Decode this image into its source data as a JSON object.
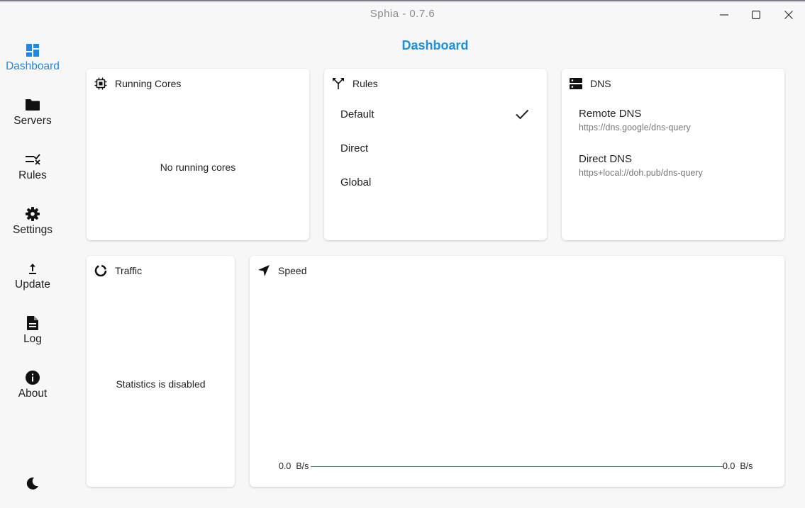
{
  "window": {
    "title": "Sphia - 0.7.6",
    "controls": [
      "minimize-icon",
      "maximize-icon",
      "close-icon"
    ]
  },
  "sidebar": {
    "items": [
      {
        "label": "Dashboard",
        "icon": "dashboard-icon",
        "active": true
      },
      {
        "label": "Servers",
        "icon": "folder-icon",
        "active": false
      },
      {
        "label": "Rules",
        "icon": "rules-icon",
        "active": false
      },
      {
        "label": "Settings",
        "icon": "gear-icon",
        "active": false
      },
      {
        "label": "Update",
        "icon": "upload-arrow-icon",
        "active": false
      },
      {
        "label": "Log",
        "icon": "document-icon",
        "active": false
      },
      {
        "label": "About",
        "icon": "info-icon",
        "active": false
      }
    ],
    "theme_toggle_icon": "moon-icon"
  },
  "page": {
    "title": "Dashboard"
  },
  "cards": {
    "running_cores": {
      "title": "Running Cores",
      "message": "No running cores"
    },
    "rules": {
      "title": "Rules",
      "options": [
        "Default",
        "Direct",
        "Global"
      ],
      "selected": "Default"
    },
    "dns": {
      "title": "DNS",
      "remote": {
        "label": "Remote DNS",
        "value": "https://dns.google/dns-query"
      },
      "direct": {
        "label": "Direct DNS",
        "value": "https+local://doh.pub/dns-query"
      }
    },
    "traffic": {
      "title": "Traffic",
      "message": "Statistics is disabled"
    },
    "speed": {
      "title": "Speed",
      "left_value": "0.0  B/s",
      "right_value": "0.0  B/s"
    }
  },
  "colors": {
    "accent": "#1e8fd8",
    "active_nav": "#1e88e5"
  }
}
